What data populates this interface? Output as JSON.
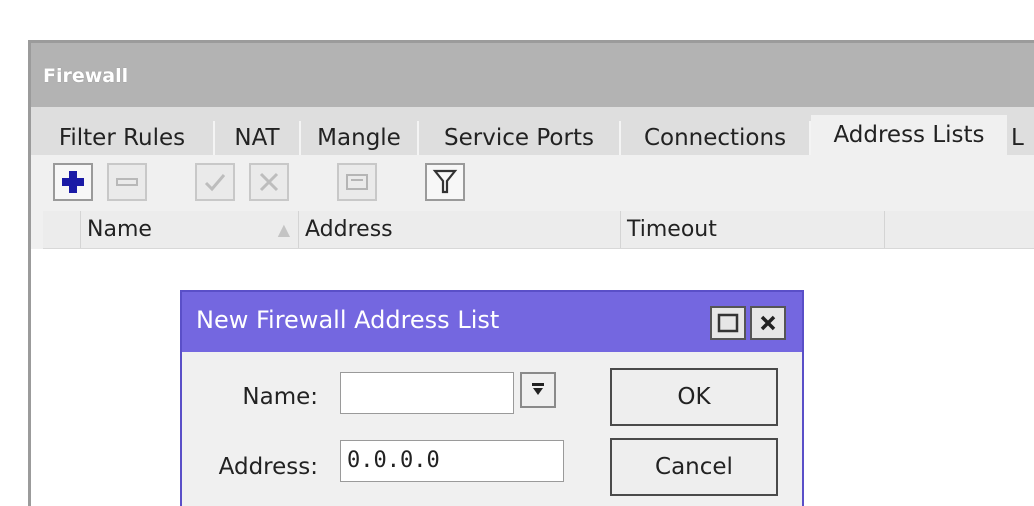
{
  "window": {
    "title": "Firewall"
  },
  "tabs": [
    "Filter Rules",
    "NAT",
    "Mangle",
    "Service Ports",
    "Connections",
    "Address Lists",
    "L"
  ],
  "active_tab": "Address Lists",
  "columns": [
    "Name",
    "Address",
    "Timeout"
  ],
  "dialog": {
    "title": "New Firewall Address List",
    "fields": {
      "name": {
        "label": "Name:",
        "value": ""
      },
      "address": {
        "label": "Address:",
        "value": "0.0.0.0"
      }
    },
    "buttons": {
      "ok": "OK",
      "cancel": "Cancel"
    }
  },
  "colors": {
    "dialog_title_bg": "#7467e0",
    "window_title_bg": "#b3b3b3",
    "add_icon": "#1a1aa6"
  },
  "icons": [
    "add-icon",
    "remove-icon",
    "enable-icon",
    "disable-icon",
    "comment-icon",
    "filter-icon",
    "sort-icon",
    "maximize-icon",
    "close-icon",
    "dropdown-icon"
  ]
}
